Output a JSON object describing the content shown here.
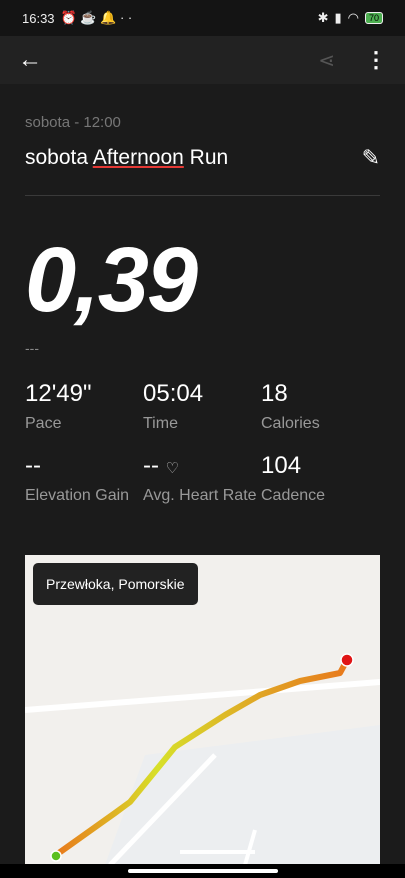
{
  "status": {
    "time": "16:33",
    "battery": "70"
  },
  "activity": {
    "date": "sobota - 12:00",
    "title_prefix": "sobota ",
    "title_mid": "Afternoon",
    "title_suffix": " Run",
    "distance": "0,39",
    "distance_unit": "---"
  },
  "stats": [
    {
      "value": "12'49\"",
      "label": "Pace"
    },
    {
      "value": "05:04",
      "label": "Time"
    },
    {
      "value": "18",
      "label": "Calories"
    },
    {
      "value": "--",
      "label": "Elevation Gain"
    },
    {
      "value": "--",
      "label": "Avg. Heart Rate"
    },
    {
      "value": "104",
      "label": "Cadence"
    }
  ],
  "map": {
    "location": "Przewłoka, Pomorskie"
  }
}
